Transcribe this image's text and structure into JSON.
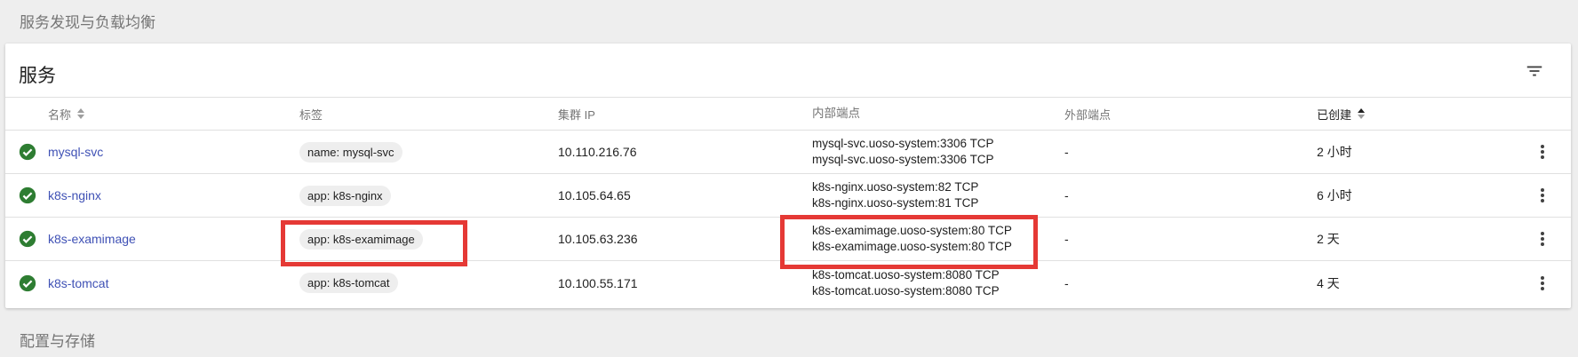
{
  "sections": {
    "top": "服务发现与负载均衡",
    "bottom": "配置与存储"
  },
  "card": {
    "title": "服务"
  },
  "columns": {
    "name": "名称",
    "labels": "标签",
    "cluster_ip": "集群 IP",
    "internal_endpoints": "内部端点",
    "external_endpoints": "外部端点",
    "age": "已创建"
  },
  "rows": [
    {
      "name": "mysql-svc",
      "label": "name: mysql-svc",
      "cluster_ip": "10.110.216.76",
      "internal": [
        "mysql-svc.uoso-system:3306 TCP",
        "mysql-svc.uoso-system:3306 TCP"
      ],
      "external": "-",
      "age": "2 小时"
    },
    {
      "name": "k8s-nginx",
      "label": "app: k8s-nginx",
      "cluster_ip": "10.105.64.65",
      "internal": [
        "k8s-nginx.uoso-system:82 TCP",
        "k8s-nginx.uoso-system:81 TCP"
      ],
      "external": "-",
      "age": "6 小时"
    },
    {
      "name": "k8s-examimage",
      "label": "app: k8s-examimage",
      "cluster_ip": "10.105.63.236",
      "internal": [
        "k8s-examimage.uoso-system:80 TCP",
        "k8s-examimage.uoso-system:80 TCP"
      ],
      "external": "-",
      "age": "2 天"
    },
    {
      "name": "k8s-tomcat",
      "label": "app: k8s-tomcat",
      "cluster_ip": "10.100.55.171",
      "internal": [
        "k8s-tomcat.uoso-system:8080 TCP",
        "k8s-tomcat.uoso-system:8080 TCP"
      ],
      "external": "-",
      "age": "4 天"
    }
  ],
  "colors": {
    "status_ok": "#2e7d32",
    "link": "#3f51b5",
    "highlight": "#e53935"
  },
  "icons": {
    "status": "check-circle-icon",
    "filter": "filter-list-icon",
    "sort": "sort-icon",
    "row_menu": "more-vert-icon"
  }
}
